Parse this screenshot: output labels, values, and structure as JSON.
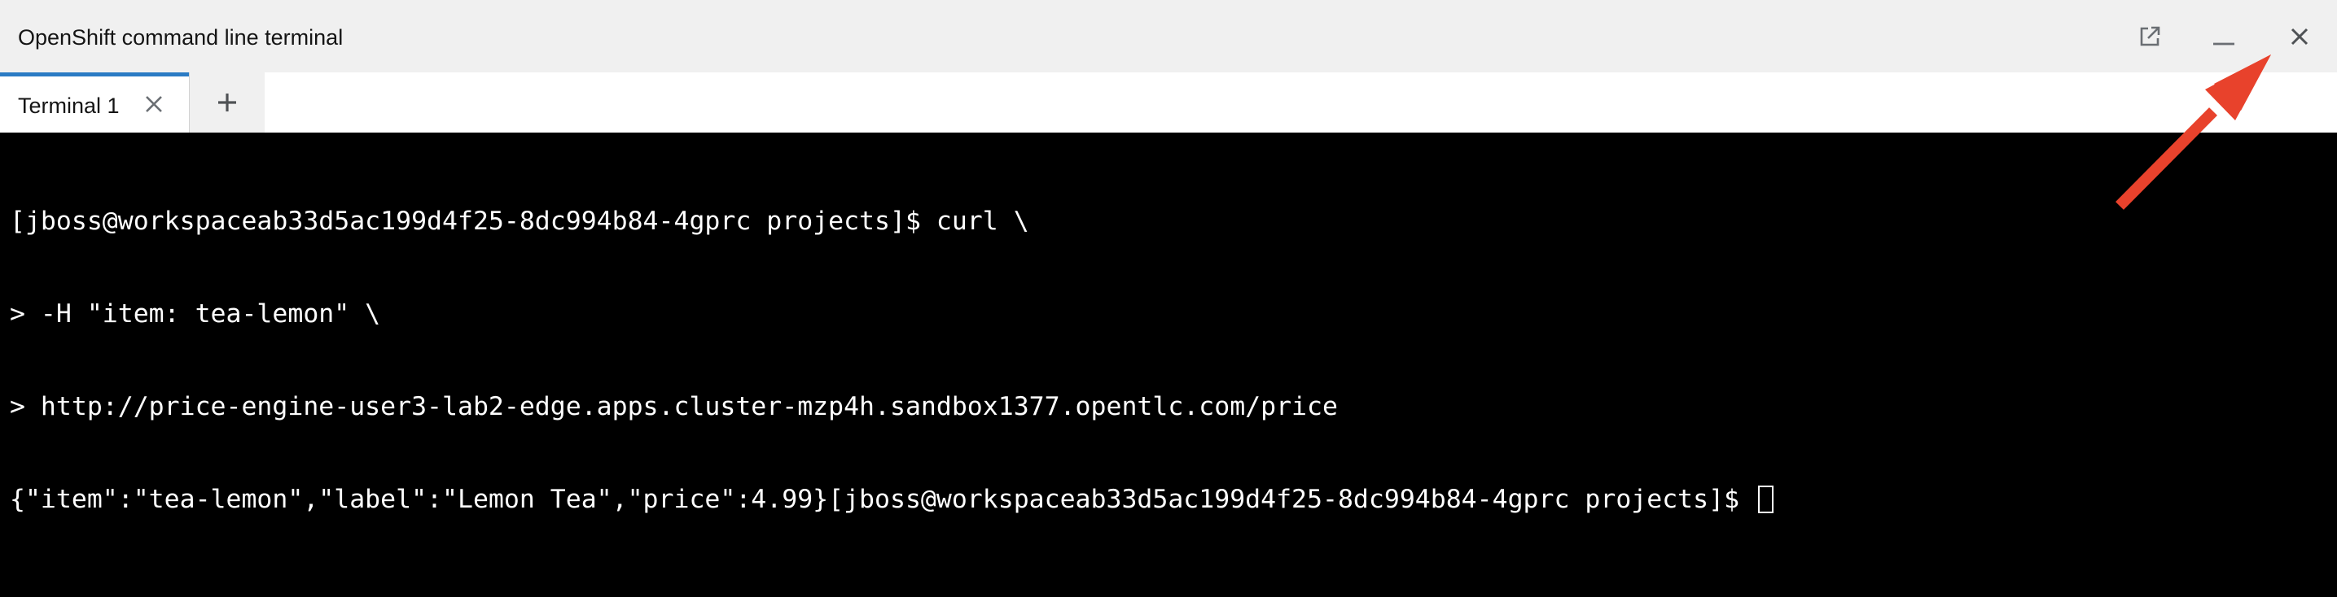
{
  "header": {
    "title": "OpenShift command line terminal",
    "buttons": {
      "open_external_icon": "external-link-icon",
      "minimize_icon": "minimize-icon",
      "close_icon": "close-icon"
    }
  },
  "tabs": {
    "items": [
      {
        "label": "Terminal 1",
        "active": true,
        "close_icon": "close-icon"
      }
    ],
    "add_icon": "plus-icon"
  },
  "terminal": {
    "lines": [
      "[jboss@workspaceab33d5ac199d4f25-8dc994b84-4gprc projects]$ curl \\",
      "> -H \"item: tea-lemon\" \\",
      "> http://price-engine-user3-lab2-edge.apps.cluster-mzp4h.sandbox1377.opentlc.com/price",
      "{\"item\":\"tea-lemon\",\"label\":\"Lemon Tea\",\"price\":4.99}[jboss@workspaceab33d5ac199d4f25-8dc994b84-4gprc projects]$ "
    ]
  },
  "colors": {
    "header_bg": "#f0f0f0",
    "tab_active_border": "#2b7bc4",
    "terminal_bg": "#000000",
    "terminal_fg": "#ffffff",
    "annotation_arrow": "#e8422c"
  }
}
